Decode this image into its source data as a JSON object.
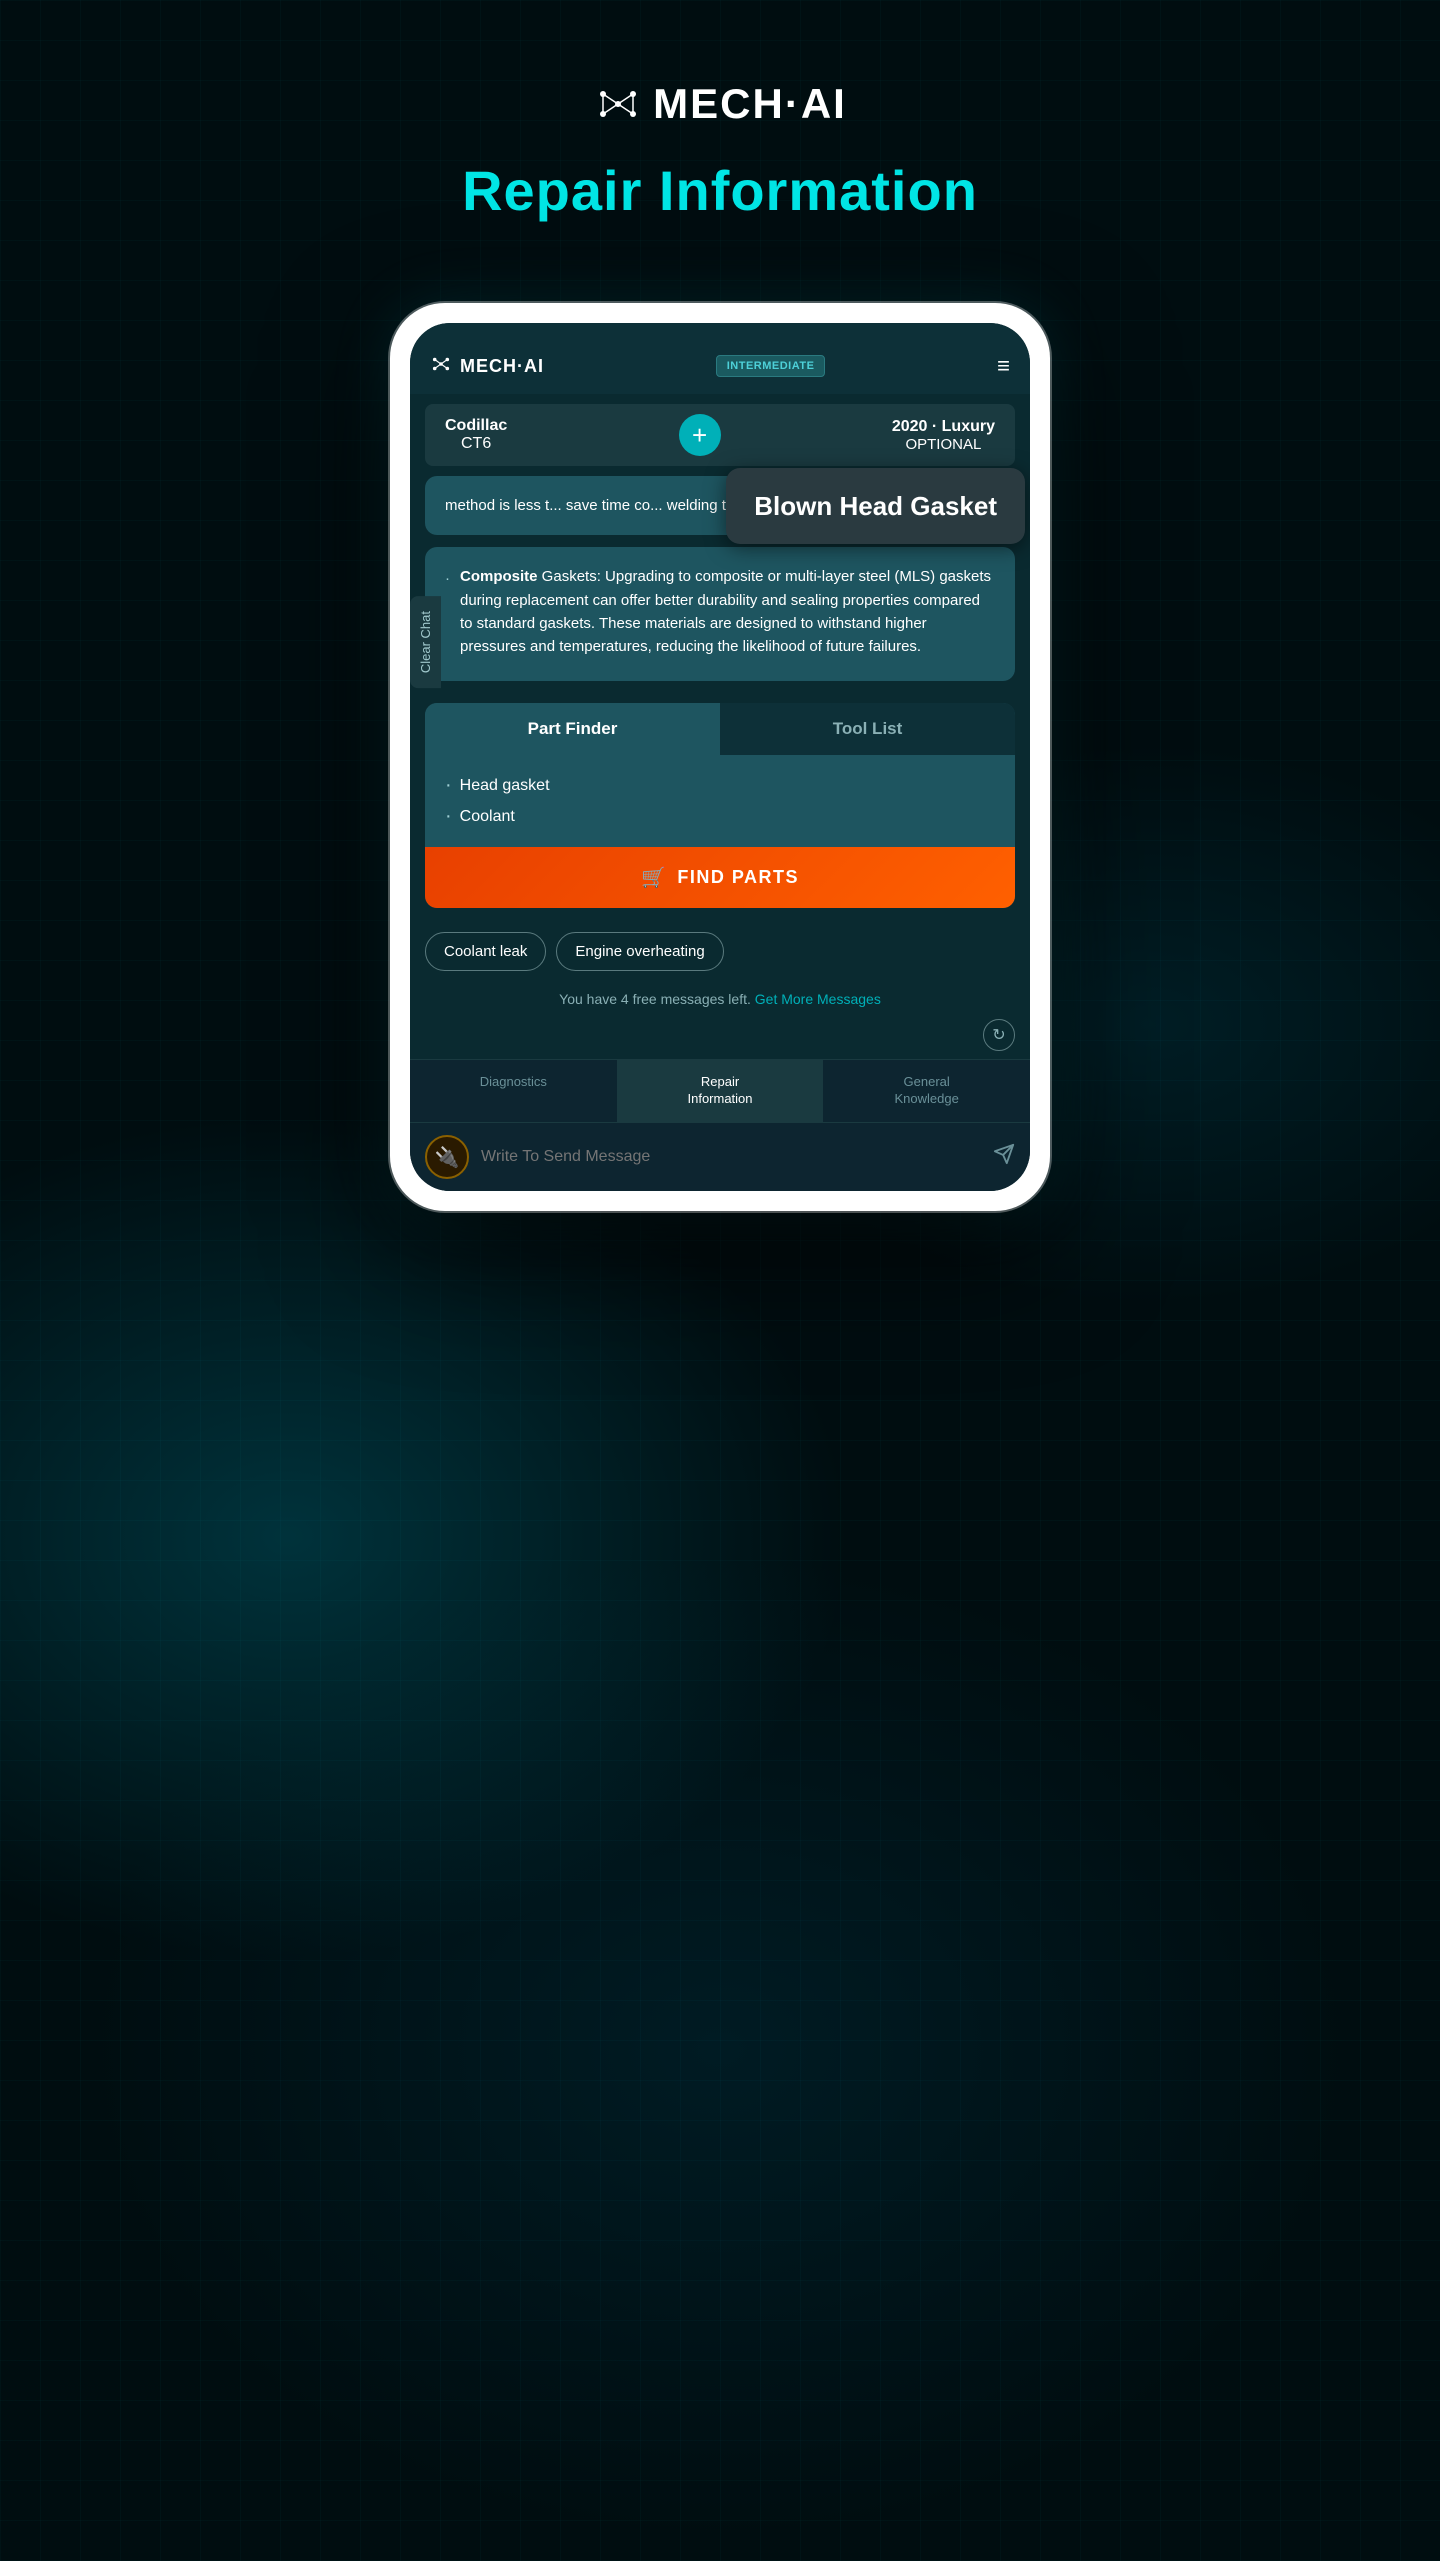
{
  "app": {
    "logo_text": "MECH·AI",
    "page_title": "Repair Information"
  },
  "phone": {
    "header": {
      "logo_text": "MECH·AI",
      "badge_label": "INTERMEDIATE",
      "menu_icon": "≡"
    },
    "vehicle_bar": {
      "left_label1": "Codillac",
      "left_label2": "CT6",
      "add_icon": "+",
      "right_label1": "2020 · Luxury",
      "right_label2": "OPTIONAL"
    },
    "clear_chat_label": "Clear Chat",
    "tooltip": {
      "text": "Blown Head Gasket"
    },
    "chat_content": {
      "truncated_text": "method is less t... save time co... welding techn...",
      "full_bullet": "Composite Gaskets: Upgrading to composite or multi-layer steel (MLS) gaskets during replacement can offer better durability and sealing properties compared to standard gaskets. These materials are designed to withstand higher pressures and temperatures, reducing the likelihood of future failures.",
      "bullet_bold": "Composite",
      "bullet_rest": " Gaskets: Upgrading to composite or multi-layer steel (MLS) gaskets during replacement can offer better durability and sealing properties compared to standard gaskets. These materials are designed to withstand higher pressures and temperatures, reducing the likelihood of future failures."
    },
    "tabs": {
      "tab1": "Part Finder",
      "tab2": "Tool List",
      "active": "tab1"
    },
    "parts_list": {
      "items": [
        "Head gasket",
        "Coolant"
      ]
    },
    "find_parts_button": "FIND PARTS",
    "suggestions": {
      "chip1": "Coolant leak",
      "chip2": "Engine overheating"
    },
    "messages_info": {
      "text": "You have 4 free messages left.",
      "link_text": "Get More Messages"
    },
    "bottom_nav": {
      "items": [
        "Diagnostics",
        "Repair\nInformation",
        "General\nKnowledge"
      ],
      "active_index": 1
    },
    "input": {
      "placeholder": "Write To Send Message"
    }
  }
}
